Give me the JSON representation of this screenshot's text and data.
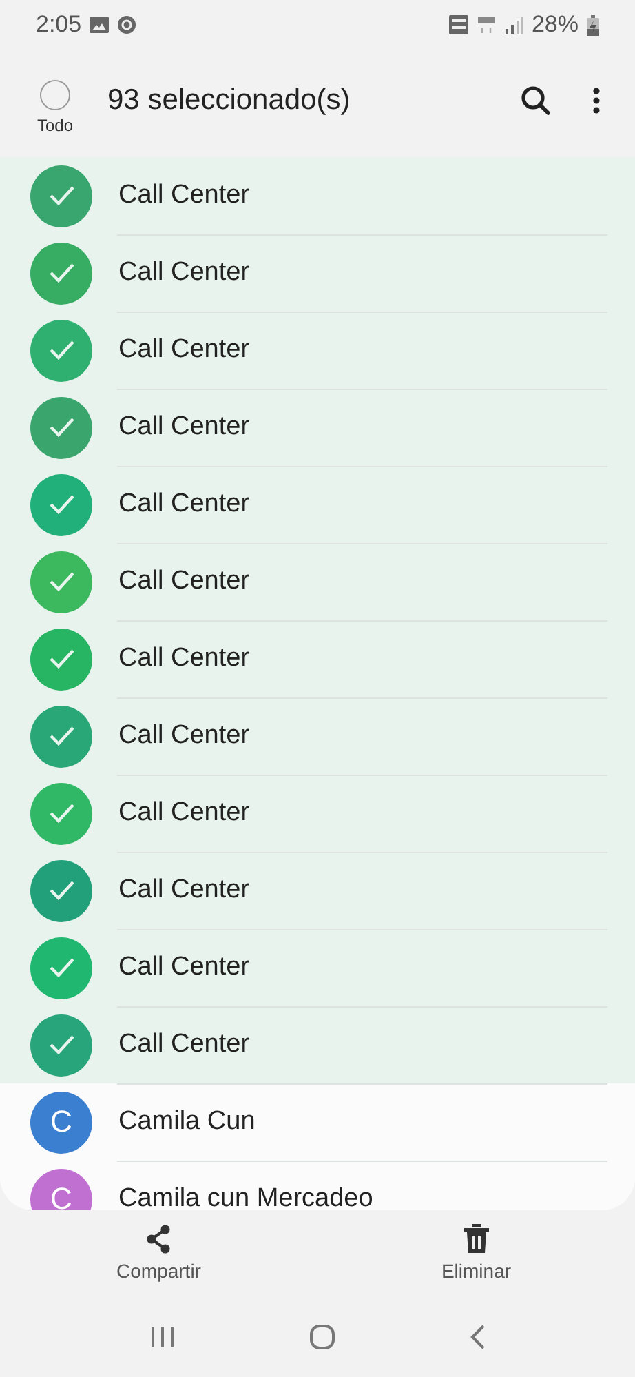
{
  "status_bar": {
    "time": "2:05",
    "battery": "28%"
  },
  "header": {
    "select_all": {
      "label": "Todo",
      "checked": false
    },
    "title": "93 seleccionado(s)"
  },
  "contacts": [
    {
      "name": "Call Center",
      "selected": true,
      "color": "#3aa66f"
    },
    {
      "name": "Call Center",
      "selected": true,
      "color": "#36ad62"
    },
    {
      "name": "Call Center",
      "selected": true,
      "color": "#2fb070"
    },
    {
      "name": "Call Center",
      "selected": true,
      "color": "#3ba56e"
    },
    {
      "name": "Call Center",
      "selected": true,
      "color": "#22b07a"
    },
    {
      "name": "Call Center",
      "selected": true,
      "color": "#3cb85e"
    },
    {
      "name": "Call Center",
      "selected": true,
      "color": "#27b463"
    },
    {
      "name": "Call Center",
      "selected": true,
      "color": "#2aa776"
    },
    {
      "name": "Call Center",
      "selected": true,
      "color": "#31b867"
    },
    {
      "name": "Call Center",
      "selected": true,
      "color": "#22a07a"
    },
    {
      "name": "Call Center",
      "selected": true,
      "color": "#20b870"
    },
    {
      "name": "Call Center",
      "selected": true,
      "color": "#28a57a"
    },
    {
      "name": "Camila Cun",
      "selected": false,
      "color": "#3a7fd0",
      "initial": "C"
    },
    {
      "name": "Camila cun Mercadeo",
      "selected": false,
      "color": "#c070d0",
      "initial": "C"
    }
  ],
  "actions": [
    {
      "kind": "share",
      "label": "Compartir"
    },
    {
      "kind": "delete",
      "label": "Eliminar"
    }
  ]
}
